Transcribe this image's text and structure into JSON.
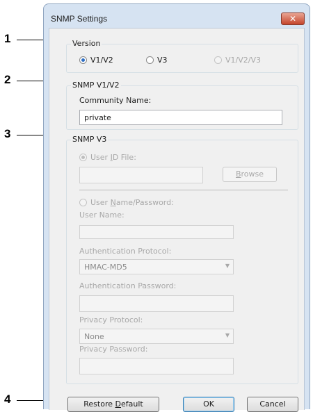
{
  "callouts": [
    "1",
    "2",
    "3",
    "4"
  ],
  "dialog": {
    "title": "SNMP Settings",
    "close_glyph": "✕"
  },
  "version": {
    "legend": "Version",
    "options": [
      "V1/V2",
      "V3",
      "V1/V2/V3"
    ],
    "selected": "V1/V2"
  },
  "snmp_v1v2": {
    "legend": "SNMP V1/V2",
    "community_label": "Community Name:",
    "community_value": "private"
  },
  "snmp_v3": {
    "legend": "SNMP V3",
    "user_id_file_label_pre": "User ",
    "user_id_file_label_key": "I",
    "user_id_file_label_post": "D File:",
    "browse_pre": "",
    "browse_key": "B",
    "browse_post": "rowse",
    "user_name_password_pre": "User ",
    "user_name_password_key": "N",
    "user_name_password_post": "ame/Password:",
    "user_name_label": "User Name:",
    "auth_protocol_label": "Authentication Protocol:",
    "auth_protocol_value": "HMAC-MD5",
    "auth_password_label": "Authentication Password:",
    "privacy_protocol_label": "Privacy Protocol:",
    "privacy_protocol_value": "None",
    "privacy_password_label": "Privacy Password:"
  },
  "buttons": {
    "restore_pre": "Restore ",
    "restore_key": "D",
    "restore_post": "efault",
    "ok": "OK",
    "cancel": "Cancel"
  }
}
